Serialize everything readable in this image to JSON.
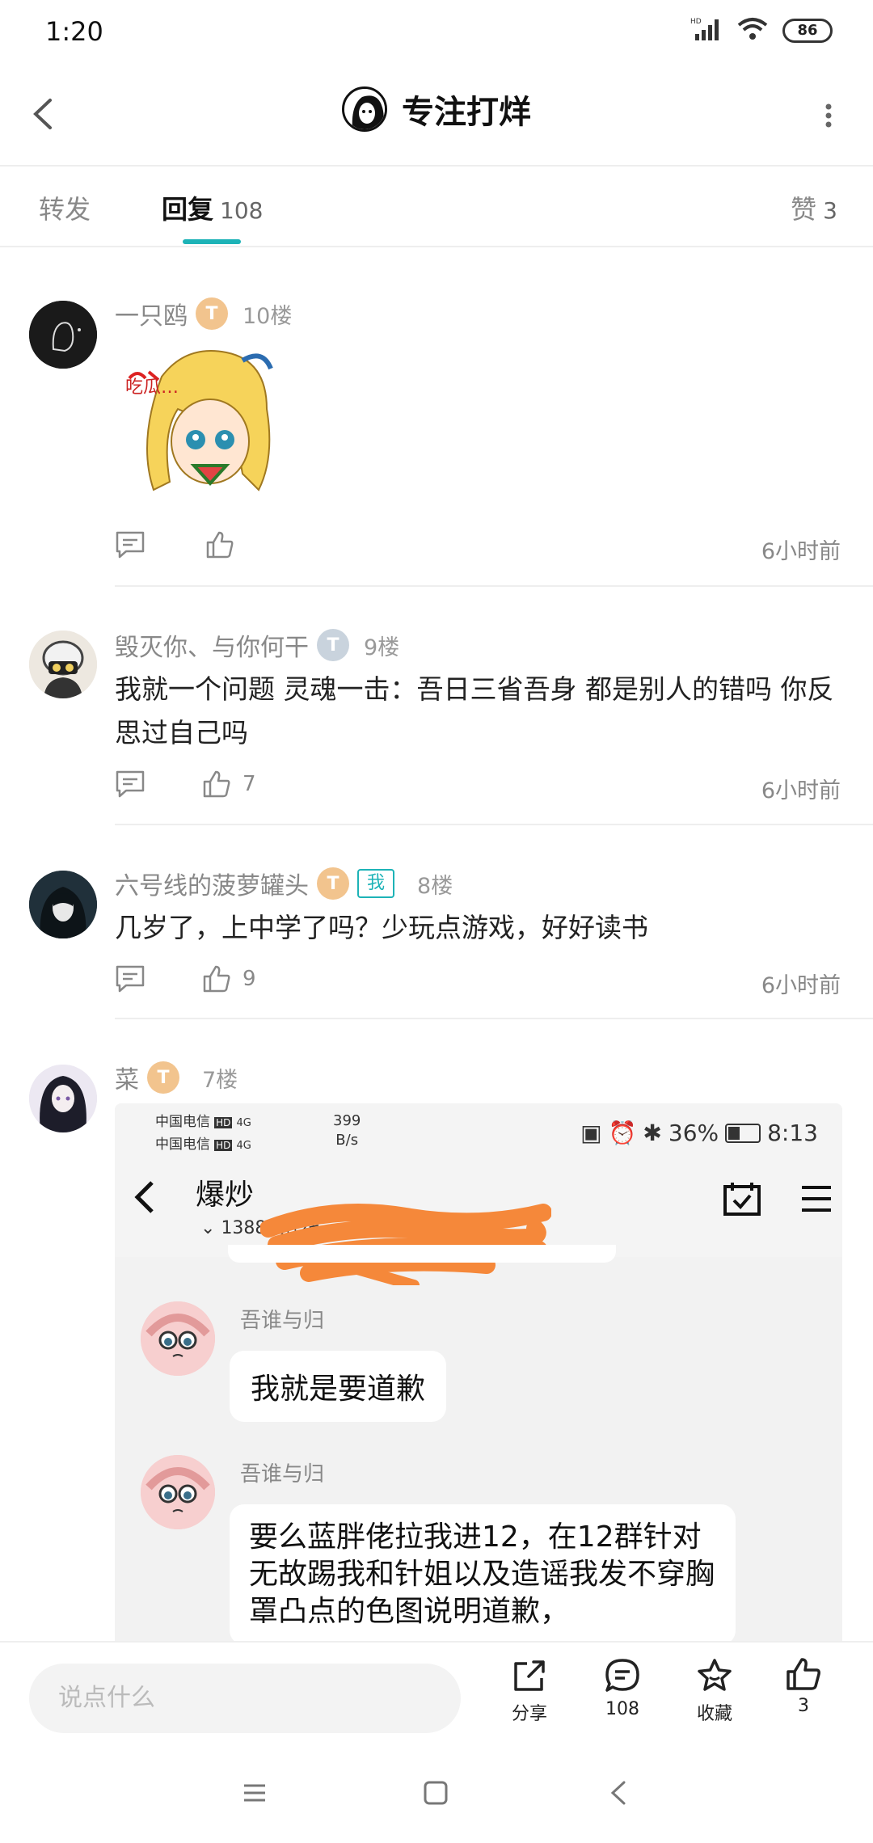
{
  "status_bar": {
    "time": "1:20",
    "battery": "86",
    "hd": "HD"
  },
  "header": {
    "title": "专注打烊",
    "back_icon": "chevron-left-icon",
    "more_icon": "more-vertical-icon"
  },
  "tabs": {
    "forward": "转发",
    "reply": "回复",
    "reply_count": "108",
    "like": "赞",
    "like_count": "3"
  },
  "replies": [
    {
      "user": "一只鸥",
      "badge": "T",
      "floor": "10楼",
      "sticker_text": "吃瓜…",
      "likes": "",
      "time": "6小时前"
    },
    {
      "user": "毁灭你、与你何干",
      "badge": "T",
      "floor": "9楼",
      "content": "我就一个问题 灵魂一击：吾日三省吾身 都是别人的错吗 你反思过自己吗",
      "likes": "7",
      "time": "6小时前"
    },
    {
      "user": "六号线的菠萝罐头",
      "badge": "T",
      "me": "我",
      "floor": "8楼",
      "content": "几岁了，上中学了吗？少玩点游戏，好好读书",
      "likes": "9",
      "time": "6小时前"
    },
    {
      "user": "菜",
      "badge": "T",
      "floor": "7楼"
    }
  ],
  "embedded_screenshot": {
    "carrier1": "中国电信",
    "carrier2": "中国电信",
    "hd1": "HD",
    "hd2": "HD",
    "net1": "4G",
    "net2": "4G",
    "speed": "399",
    "speed_unit": "B/s",
    "battery": "36%",
    "time": "8:13",
    "group_name": "爆炒",
    "online": "1388人在线",
    "messages": [
      {
        "sender": "吾谁与归",
        "text": "我就是要道歉"
      },
      {
        "sender": "吾谁与归",
        "text": "要么蓝胖佬拉我进12，在12群针对无故踢我和针姐以及造谣我发不穿胸罩凸点的色图说明道歉，"
      }
    ]
  },
  "bottom_bar": {
    "placeholder": "说点什么",
    "share": "分享",
    "comments": "108",
    "favorite": "收藏",
    "likes": "3"
  },
  "colors": {
    "accent": "#1db3b7",
    "gold_badge": "#f2c48e",
    "scribble": "#f5883a"
  }
}
